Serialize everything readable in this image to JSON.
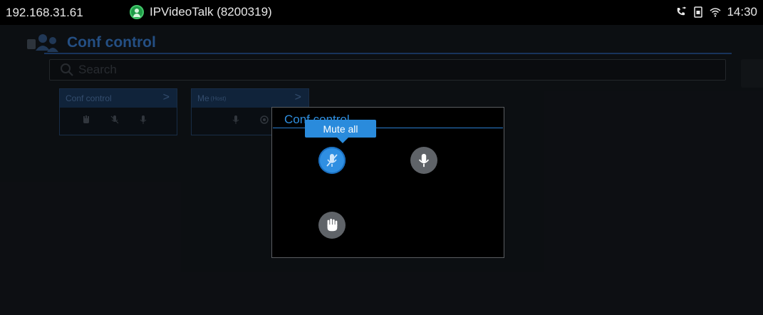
{
  "status_bar": {
    "ip": "192.168.31.61",
    "app_label": "IPVideoTalk (8200319)",
    "time": "14:30",
    "icons": [
      "app-user-icon",
      "call-icon",
      "sim-icon",
      "wifi-icon"
    ]
  },
  "header": {
    "title": "Conf control",
    "icon": "conference-icon"
  },
  "search": {
    "placeholder": "Search"
  },
  "cards": [
    {
      "label": "Conf control",
      "chevron": ">",
      "icons": [
        "hand-icon",
        "mic-muted-icon",
        "mic-icon"
      ]
    },
    {
      "label": "Me",
      "sublabel": "(Host)",
      "chevron": ">",
      "icons": [
        "mic-icon",
        "camera-icon"
      ]
    }
  ],
  "dialog": {
    "title": "Conf control",
    "buttons": [
      {
        "name": "mute-all",
        "icon": "mic-muted-icon",
        "selected": true
      },
      {
        "name": "unmute-all",
        "icon": "mic-icon",
        "selected": false
      },
      {
        "name": "raise-hand",
        "icon": "hand-icon",
        "selected": false
      }
    ]
  },
  "tooltip": {
    "text": "Mute all"
  },
  "colors": {
    "accent": "#2f8fe2",
    "header_title": "#2b5d9a",
    "background": "#0f1216"
  }
}
